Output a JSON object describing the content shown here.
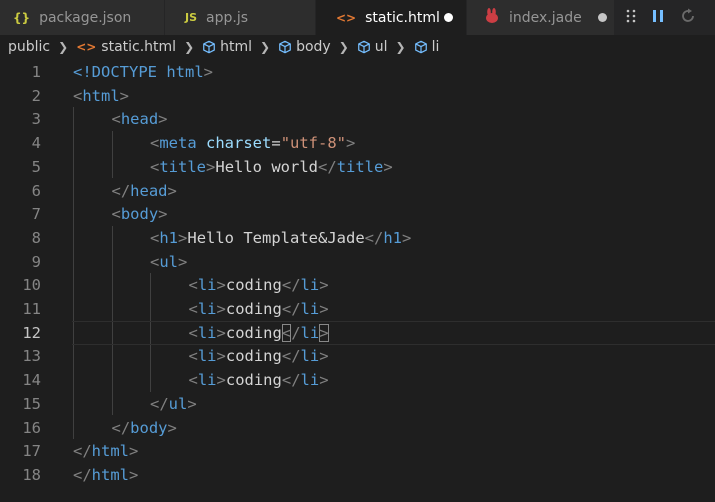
{
  "tabs": [
    {
      "icon": "{}",
      "icon_name": "json-braces-icon",
      "icon_color": "#cbcb41",
      "label": "package.json",
      "active": false,
      "dirty": false
    },
    {
      "icon": "JS",
      "icon_name": "javascript-icon",
      "icon_color": "#cbcb41",
      "label": "app.js",
      "active": false,
      "dirty": false
    },
    {
      "icon": "<>",
      "icon_name": "html-icon",
      "icon_color": "#e37933",
      "label": "static.html",
      "active": true,
      "dirty": true
    },
    {
      "icon": "☻",
      "icon_name": "jade-icon",
      "icon_color": "#cc3e44",
      "label": "index.jade",
      "active": false,
      "dirty": true
    }
  ],
  "breadcrumb": {
    "folder": "public",
    "file": "static.html",
    "symbols": [
      "html",
      "body",
      "ul",
      "li"
    ]
  },
  "colors": {
    "tag": "#569cd6",
    "attribute": "#9cdcfe",
    "string": "#ce9178",
    "text": "#d4d4d4",
    "punctuation": "#808080"
  },
  "editor": {
    "current_line": 12,
    "lines": [
      {
        "n": "1",
        "indent": 0,
        "tokens": [
          [
            "doc",
            "<!DOCTYPE "
          ],
          [
            "tag",
            "html"
          ],
          [
            "punc",
            ">"
          ]
        ]
      },
      {
        "n": "2",
        "indent": 0,
        "tokens": [
          [
            "punc",
            "<"
          ],
          [
            "tag",
            "html"
          ],
          [
            "punc",
            ">"
          ]
        ]
      },
      {
        "n": "3",
        "indent": 1,
        "tokens": [
          [
            "punc",
            "<"
          ],
          [
            "tag",
            "head"
          ],
          [
            "punc",
            ">"
          ]
        ]
      },
      {
        "n": "4",
        "indent": 2,
        "tokens": [
          [
            "punc",
            "<"
          ],
          [
            "tag",
            "meta"
          ],
          [
            "text",
            " "
          ],
          [
            "attr",
            "charset"
          ],
          [
            "text",
            "="
          ],
          [
            "str",
            "\"utf-8\""
          ],
          [
            "punc",
            ">"
          ]
        ]
      },
      {
        "n": "5",
        "indent": 2,
        "tokens": [
          [
            "punc",
            "<"
          ],
          [
            "tag",
            "title"
          ],
          [
            "punc",
            ">"
          ],
          [
            "text",
            "Hello world"
          ],
          [
            "punc",
            "</"
          ],
          [
            "tag",
            "title"
          ],
          [
            "punc",
            ">"
          ]
        ]
      },
      {
        "n": "6",
        "indent": 1,
        "tokens": [
          [
            "punc",
            "</"
          ],
          [
            "tag",
            "head"
          ],
          [
            "punc",
            ">"
          ]
        ]
      },
      {
        "n": "7",
        "indent": 1,
        "tokens": [
          [
            "punc",
            "<"
          ],
          [
            "tag",
            "body"
          ],
          [
            "punc",
            ">"
          ]
        ]
      },
      {
        "n": "8",
        "indent": 2,
        "tokens": [
          [
            "punc",
            "<"
          ],
          [
            "tag",
            "h1"
          ],
          [
            "punc",
            ">"
          ],
          [
            "text",
            "Hello Template&Jade"
          ],
          [
            "punc",
            "</"
          ],
          [
            "tag",
            "h1"
          ],
          [
            "punc",
            ">"
          ]
        ]
      },
      {
        "n": "9",
        "indent": 2,
        "tokens": [
          [
            "punc",
            "<"
          ],
          [
            "tag",
            "ul"
          ],
          [
            "punc",
            ">"
          ]
        ]
      },
      {
        "n": "10",
        "indent": 3,
        "tokens": [
          [
            "punc",
            "<"
          ],
          [
            "tag",
            "li"
          ],
          [
            "punc",
            ">"
          ],
          [
            "text",
            "coding"
          ],
          [
            "punc",
            "</"
          ],
          [
            "tag",
            "li"
          ],
          [
            "punc",
            ">"
          ]
        ]
      },
      {
        "n": "11",
        "indent": 3,
        "tokens": [
          [
            "punc",
            "<"
          ],
          [
            "tag",
            "li"
          ],
          [
            "punc",
            ">"
          ],
          [
            "text",
            "coding"
          ],
          [
            "punc",
            "</"
          ],
          [
            "tag",
            "li"
          ],
          [
            "punc",
            ">"
          ]
        ]
      },
      {
        "n": "12",
        "indent": 3,
        "tokens": [
          [
            "punc",
            "<"
          ],
          [
            "tag",
            "li"
          ],
          [
            "punc",
            ">"
          ],
          [
            "text",
            "coding"
          ],
          [
            "punc",
            "</"
          ],
          [
            "tag",
            "li"
          ],
          [
            "punc",
            ">"
          ]
        ]
      },
      {
        "n": "13",
        "indent": 3,
        "tokens": [
          [
            "punc",
            "<"
          ],
          [
            "tag",
            "li"
          ],
          [
            "punc",
            ">"
          ],
          [
            "text",
            "coding"
          ],
          [
            "punc",
            "</"
          ],
          [
            "tag",
            "li"
          ],
          [
            "punc",
            ">"
          ]
        ]
      },
      {
        "n": "14",
        "indent": 3,
        "tokens": [
          [
            "punc",
            "<"
          ],
          [
            "tag",
            "li"
          ],
          [
            "punc",
            ">"
          ],
          [
            "text",
            "coding"
          ],
          [
            "punc",
            "</"
          ],
          [
            "tag",
            "li"
          ],
          [
            "punc",
            ">"
          ]
        ]
      },
      {
        "n": "15",
        "indent": 2,
        "tokens": [
          [
            "punc",
            "</"
          ],
          [
            "tag",
            "ul"
          ],
          [
            "punc",
            ">"
          ]
        ]
      },
      {
        "n": "16",
        "indent": 1,
        "tokens": [
          [
            "punc",
            "</"
          ],
          [
            "tag",
            "body"
          ],
          [
            "punc",
            ">"
          ]
        ]
      },
      {
        "n": "17",
        "indent": 0,
        "tokens": [
          [
            "punc",
            "</"
          ],
          [
            "tag",
            "html"
          ],
          [
            "punc",
            ">"
          ]
        ]
      },
      {
        "n": "18",
        "indent": 0,
        "tokens": [
          [
            "punc",
            "</"
          ],
          [
            "tag",
            "html"
          ],
          [
            "punc",
            ">"
          ]
        ]
      }
    ]
  }
}
